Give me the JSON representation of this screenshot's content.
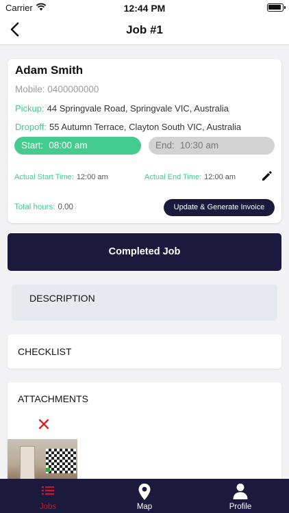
{
  "status_bar": {
    "carrier": "Carrier",
    "time": "12:44 PM"
  },
  "nav": {
    "title": "Job #1",
    "back_icon": "chevron-left-icon"
  },
  "job": {
    "customer_name": "Adam Smith",
    "mobile_label": "Mobile:",
    "mobile_value": "0400000000",
    "pickup_label": "Pickup:",
    "pickup_value": "44 Springvale Road, Springvale VIC, Australia",
    "dropoff_label": "Dropoff:",
    "dropoff_value": "55 Autumn Terrace, Clayton South VIC, Australia",
    "start_label": "Start:",
    "start_value": "08:00 am",
    "end_label": "End:",
    "end_value": "10:30 am",
    "actual_start_label": "Actual Start Time:",
    "actual_start_value": "12:00 am",
    "actual_end_label": "Actual End Time:",
    "actual_end_value": "12:00 am",
    "total_hours_label": "Total hours:",
    "total_hours_value": "0.00",
    "invoice_button": "Update & Generate Invoice"
  },
  "completed_button": "Completed Job",
  "description": {
    "title": "DESCRIPTION"
  },
  "checklist": {
    "title": "CHECKLIST"
  },
  "attachments": {
    "title": "ATTACHMENTS"
  },
  "tabs": [
    {
      "label": "Jobs",
      "icon": "list-icon",
      "active": true
    },
    {
      "label": "Map",
      "icon": "map-pin-icon",
      "active": false
    },
    {
      "label": "Profile",
      "icon": "person-icon",
      "active": false
    }
  ],
  "colors": {
    "accent_green": "#44cb8e",
    "navy": "#1b1a3c",
    "tab_active": "#c8172c",
    "remove_red": "#e02020"
  }
}
